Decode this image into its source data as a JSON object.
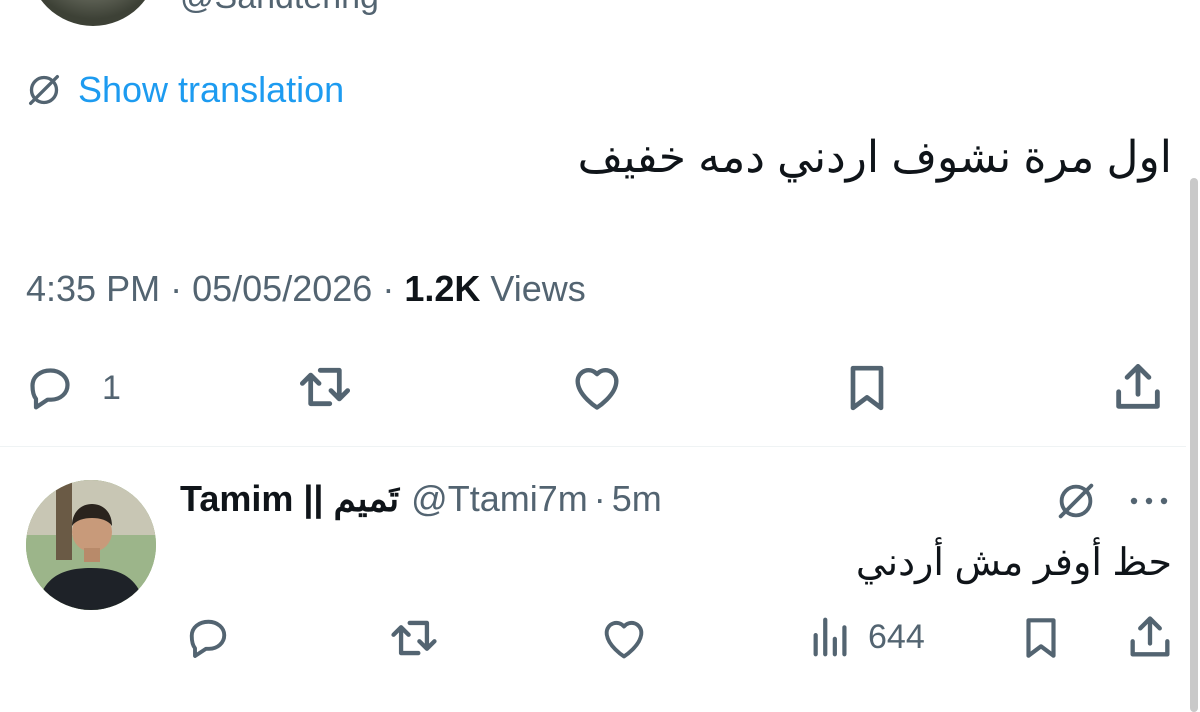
{
  "prev_handle": "@Sandtering",
  "translate": {
    "label": "Show translation"
  },
  "tweet": {
    "text": "اول مرة نشوف اردني دمه خفيف",
    "time": "4:35 PM",
    "sep1": "·",
    "date": "05/05/2026",
    "sep2": "·",
    "views_count": "1.2K",
    "views_label": "Views",
    "reply_count": "1"
  },
  "reply": {
    "name": "Tamim || تَميم",
    "handle": "@Ttami7m",
    "sep": "·",
    "age": "5m",
    "text": "حظ أوفر مش أردني",
    "views": "644"
  },
  "colors": {
    "accent": "#1d9bf0",
    "text": "#0f1419",
    "muted": "#536471",
    "divider": "#eff3f4"
  },
  "icons": [
    "translate-icon",
    "reply-icon",
    "retweet-icon",
    "like-icon",
    "bookmark-icon",
    "share-icon",
    "grok-icon",
    "more-icon",
    "views-icon"
  ]
}
